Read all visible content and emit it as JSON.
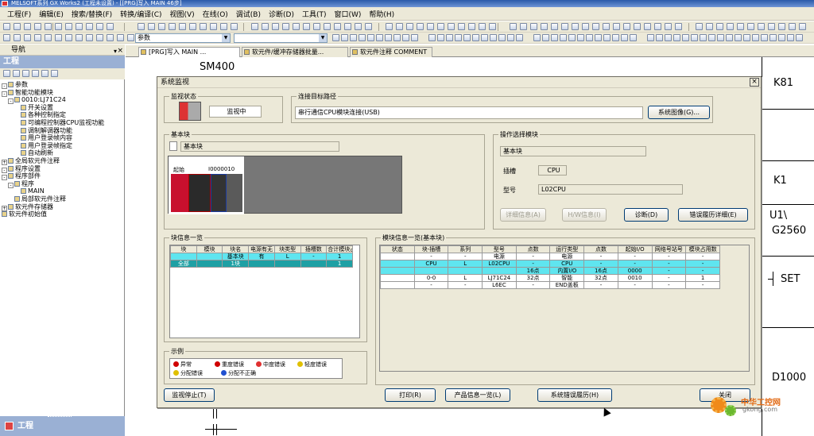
{
  "window": {
    "title": "MELSOFT系列 GX Works2 (工程未设置) - [[PRG]写入 MAIN 46步]"
  },
  "menu": [
    "工程(F)",
    "编辑(E)",
    "搜索/替换(F)",
    "转换/编译(C)",
    "视图(V)",
    "在线(O)",
    "调试(B)",
    "诊断(D)",
    "工具(T)",
    "窗口(W)",
    "帮助(H)"
  ],
  "toolbar": {
    "combo_value": "参数"
  },
  "navigation": {
    "title": "导航",
    "pin": "▾ ×",
    "section": "工程",
    "bottom_section": "工程",
    "tree": [
      {
        "label": "参数",
        "pm": "-"
      },
      {
        "label": "智能功能模块",
        "pm": "-"
      },
      {
        "label": "0010:LJ71C24",
        "pm": "-"
      },
      {
        "label": "开关设置",
        "pm": ""
      },
      {
        "label": "各种控制指定",
        "pm": ""
      },
      {
        "label": "可编程控制器CPU监视功能",
        "pm": ""
      },
      {
        "label": "调制解调器功能",
        "pm": ""
      },
      {
        "label": "用户登录帧内容",
        "pm": ""
      },
      {
        "label": "用户登录帧指定",
        "pm": ""
      },
      {
        "label": "自动刷新",
        "pm": ""
      },
      {
        "label": "全局软元件注释",
        "pm": "+"
      },
      {
        "label": "程序设置",
        "pm": "-"
      },
      {
        "label": "程序部件",
        "pm": "-"
      },
      {
        "label": "程序",
        "pm": "-"
      },
      {
        "label": "MAIN",
        "pm": ""
      },
      {
        "label": "局部软元件注释",
        "pm": ""
      },
      {
        "label": "软元件存储器",
        "pm": "+"
      },
      {
        "label": "软元件初始值",
        "pm": ""
      }
    ]
  },
  "tabs": [
    {
      "label": "[PRG]写入 MAIN ...",
      "active": true
    },
    {
      "label": "软元件/缓冲存储器批量...",
      "active": false
    },
    {
      "label": "软元件注释 COMMENT",
      "active": false
    }
  ],
  "ladder": {
    "top_label": "SM400",
    "right_labels": [
      "K81",
      "K1",
      "U1\\",
      "G2560",
      "SET",
      "D1000"
    ]
  },
  "dialog": {
    "title": "系统监视",
    "monitor_status_label": "监视状态",
    "monitor_status_value": "监视中",
    "connection_path_label": "连接目标路径",
    "connection_path_value": "串行通信CPU模块连接(USB)",
    "system_image_button": "系统图像(G)...",
    "base_label": "基本块",
    "base_field": "基本块",
    "base_start_label": "起始",
    "base_addr_label": "I0000010",
    "operation_label": "操作选择模块",
    "op_field": "基本块",
    "slot_label": "插槽",
    "slot_value": "CPU",
    "model_label": "型号",
    "model_value": "L02CPU",
    "detail_btn": "详细信息(A)",
    "hw_btn": "H/W信息(I)",
    "diag_btn": "诊断(D)",
    "err_hist_btn": "错误履历详细(E)",
    "block_list_label": "块信息一览",
    "block_headers": [
      "块",
      "模块",
      "块名",
      "电源有无",
      "块类型",
      "插槽数",
      "合计模块占用数"
    ],
    "block_rows": [
      [
        "",
        "",
        "基本块",
        "有",
        "L",
        "-",
        "1"
      ],
      [
        "全部",
        "",
        "1块",
        "",
        "",
        "",
        "1"
      ]
    ],
    "module_list_label": "模块信息一览(基本块)",
    "module_headers": [
      "状态",
      "块-插槽",
      "系列",
      "型号",
      "点数",
      "运行类型",
      "点数",
      "起始I/O",
      "网络号站号",
      "模块占用数"
    ],
    "module_header_group": "运行",
    "module_rows": [
      {
        "cls": "",
        "cells": [
          "",
          "-",
          "-",
          "电源",
          "-",
          "电源",
          "-",
          "-",
          "-",
          "-"
        ]
      },
      {
        "cls": "cyan",
        "cells": [
          "",
          "CPU",
          "L",
          "L02CPU",
          "-",
          "CPU",
          "-",
          "-",
          "-",
          "-"
        ]
      },
      {
        "cls": "cyan",
        "cells": [
          "",
          "",
          "",
          "",
          "16点",
          "内置I/O",
          "16点",
          "0000",
          "-",
          "-"
        ]
      },
      {
        "cls": "",
        "cells": [
          "",
          "0-0",
          "L",
          "LJ71C24",
          "32点",
          "智能",
          "32点",
          "0010",
          "-",
          "1"
        ]
      },
      {
        "cls": "",
        "cells": [
          "",
          "-",
          "-",
          "L6EC",
          "-",
          "END盖板",
          "-",
          "-",
          "-",
          "-"
        ]
      }
    ],
    "legend_label": "示例",
    "legend_items": [
      {
        "label": "异常",
        "color": "#d00000"
      },
      {
        "label": "重度错误",
        "color": "#d00000"
      },
      {
        "label": "中度错误",
        "color": "#e03030"
      },
      {
        "label": "轻度错误",
        "color": "#e0c000"
      },
      {
        "label": "分配错误",
        "color": "#e0c000"
      },
      {
        "label": "分配不正确",
        "color": "#2050d0"
      }
    ],
    "stop_monitor_btn": "监视停止(T)",
    "print_btn": "打印(R)",
    "product_info_btn": "产品信息一览(L)",
    "sys_err_hist_btn": "系统错误履历(H)",
    "close_btn": "关闭"
  },
  "watermark": {
    "text1": "中华工控网",
    "text2": "gkong.com"
  }
}
